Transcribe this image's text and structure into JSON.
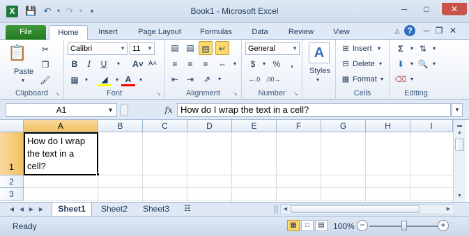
{
  "window": {
    "title": "Book1  -  Microsoft Excel"
  },
  "quick_access": {
    "icons": [
      "excel-logo",
      "save-icon",
      "undo-icon",
      "redo-icon",
      "customize-icon"
    ]
  },
  "tabs": [
    {
      "label": "File"
    },
    {
      "label": "Home"
    },
    {
      "label": "Insert"
    },
    {
      "label": "Page Layout"
    },
    {
      "label": "Formulas"
    },
    {
      "label": "Data"
    },
    {
      "label": "Review"
    },
    {
      "label": "View"
    }
  ],
  "ribbon": {
    "clipboard": {
      "label": "Clipboard",
      "paste_label": "Paste"
    },
    "font": {
      "label": "Font",
      "font_name": "Calibri",
      "font_size": "11",
      "bold": "B",
      "italic": "I",
      "underline": "U",
      "font_color": "#ff0000",
      "fill_color": "#ffff00"
    },
    "alignment": {
      "label": "Alignment"
    },
    "number": {
      "label": "Number",
      "format": "General",
      "currency": "$",
      "percent": "%"
    },
    "styles": {
      "label": "Styles"
    },
    "cells": {
      "label": "Cells",
      "insert": "Insert",
      "delete": "Delete",
      "format": "Format"
    },
    "editing": {
      "label": "Editing"
    }
  },
  "formula_bar": {
    "name_box": "A1",
    "fx": "fx",
    "content": "How do I wrap the text in a cell?"
  },
  "grid": {
    "columns": [
      "A",
      "B",
      "C",
      "D",
      "E",
      "F",
      "G",
      "H",
      "I"
    ],
    "rows": [
      "1",
      "2",
      "3"
    ],
    "selected_cell": "A1",
    "a1_text": "How do I wrap the text in a cell?"
  },
  "sheets": [
    {
      "label": "Sheet1"
    },
    {
      "label": "Sheet2"
    },
    {
      "label": "Sheet3"
    }
  ],
  "status": {
    "ready": "Ready",
    "zoom": "100%"
  }
}
